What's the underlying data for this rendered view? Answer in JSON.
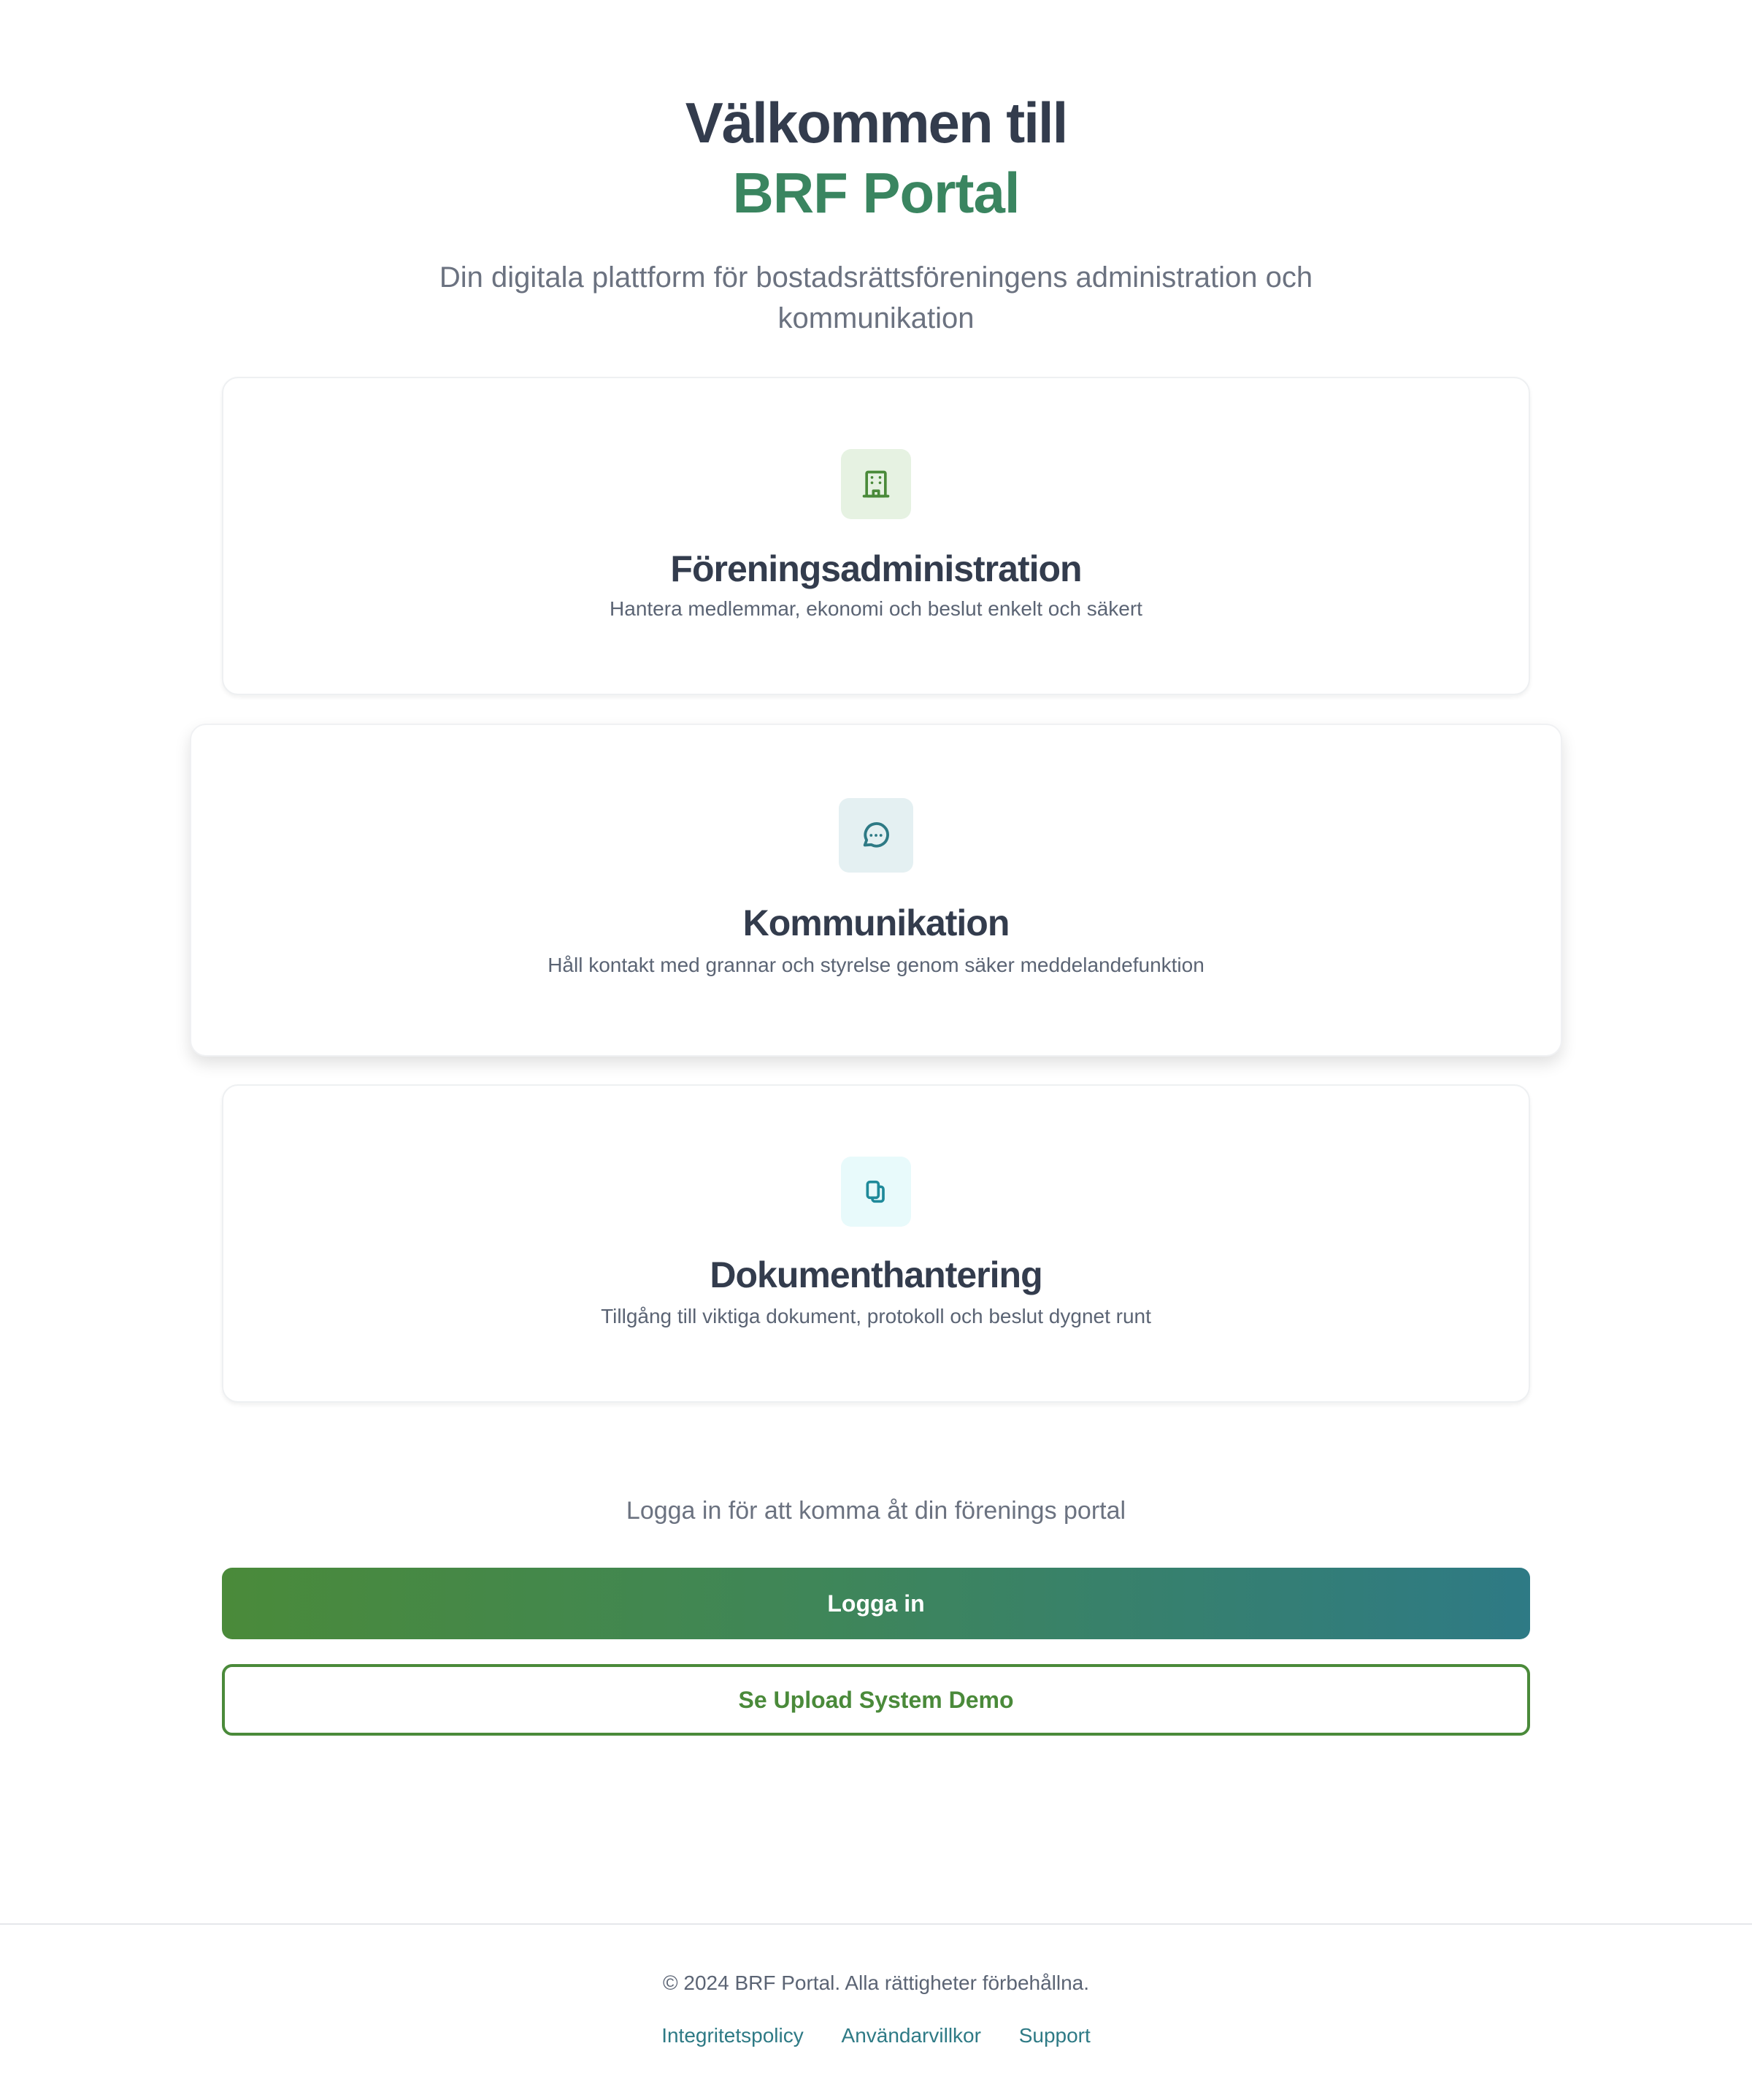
{
  "hero": {
    "title": "Välkommen till",
    "brand": "BRF Portal",
    "subtitle": "Din digitala plattform för bostadsrättsföreningens administration och kommunikation"
  },
  "features": [
    {
      "icon": "building-icon",
      "title": "Föreningsadministration",
      "description": "Hantera medlemmar, ekonomi och beslut enkelt och säkert"
    },
    {
      "icon": "chat-bubble-icon",
      "title": "Kommunikation",
      "description": "Håll kontakt med grannar och styrelse genom säker meddelandefunktion"
    },
    {
      "icon": "documents-icon",
      "title": "Dokumenthantering",
      "description": "Tillgång till viktiga dokument, protokoll och beslut dygnet runt"
    }
  ],
  "login": {
    "hint": "Logga in för att komma åt din förenings portal",
    "login_label": "Logga in",
    "demo_label": "Se Upload System Demo"
  },
  "footer": {
    "copyright": "© 2024 BRF Portal. Alla rättigheter förbehållna.",
    "links": [
      "Integritetspolicy",
      "Användarvillkor",
      "Support"
    ]
  },
  "colors": {
    "brand_green": "#3a8560",
    "button_green": "#4a8a3a",
    "teal": "#2e7a85",
    "heading": "#333c4d",
    "muted": "#6b7280"
  }
}
